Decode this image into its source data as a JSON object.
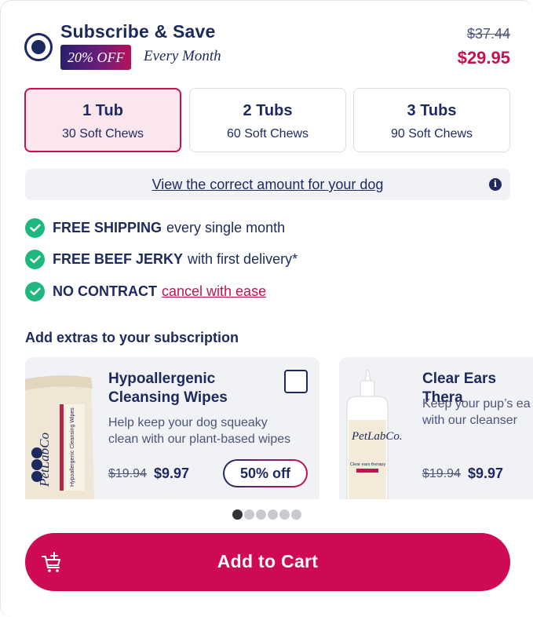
{
  "plan": {
    "title": "Subscribe & Save",
    "discount_label": "20% OFF",
    "frequency": "Every Month",
    "old_price": "$37.44",
    "new_price": "$29.95",
    "selected": true
  },
  "tubs": [
    {
      "label": "1 Tub",
      "sub": "30 Soft Chews",
      "selected": true
    },
    {
      "label": "2 Tubs",
      "sub": "60 Soft Chews",
      "selected": false
    },
    {
      "label": "3 Tubs",
      "sub": "90 Soft Chews",
      "selected": false
    }
  ],
  "info_bar": {
    "link_text": "View the correct amount for your dog",
    "icon": "info-icon"
  },
  "benefits": [
    {
      "bold": "FREE SHIPPING",
      "text": "every single month",
      "link": ""
    },
    {
      "bold": "FREE BEEF JERKY",
      "text": "with first delivery*",
      "link": ""
    },
    {
      "bold": "NO CONTRACT",
      "text": "",
      "link": "cancel with ease"
    }
  ],
  "extras": {
    "heading": "Add extras to your subscription",
    "cards": [
      {
        "title_line1": "Hypoallergenic",
        "title_line2": "Cleansing Wipes",
        "desc_line1": "Help keep your dog squeaky",
        "desc_line2": "clean with our plant-based wipes",
        "old_price": "$19.94",
        "new_price": "$9.97",
        "badge": "50% off",
        "checked": false,
        "image_brand": "PetLabCo",
        "image_product": "Hypoallergenic Cleansing Wipes"
      },
      {
        "title_line1": "Clear Ears Thera",
        "desc_line1": "Keep your pup’s ea",
        "desc_line2": "with our cleanser",
        "old_price": "$19.94",
        "new_price": "$9.97",
        "image_brand": "PetLabCo.",
        "image_product": "Clear ears therapy"
      }
    ],
    "pagination": {
      "total": 6,
      "active": 0
    }
  },
  "cart": {
    "label": "Add to Cart",
    "icon": "cart-plus-icon"
  },
  "colors": {
    "navy": "#1c2a5e",
    "accent": "#c4124f",
    "cart_button": "#cf0a55",
    "selected_bg": "#fbe6ee",
    "check_green": "#1fb77d",
    "card_bg": "#f1f2f6"
  }
}
